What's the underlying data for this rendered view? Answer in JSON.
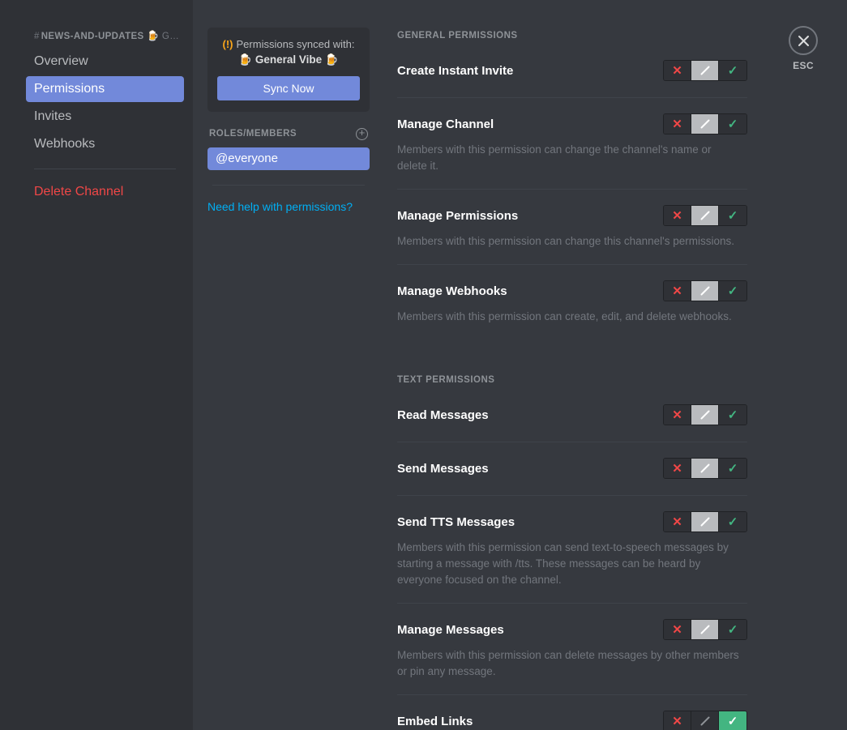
{
  "sidebar": {
    "channel_hash": "#",
    "channel_name": "NEWS-AND-UPDATES",
    "channel_emoji": "🍺",
    "channel_truncated": "G…",
    "items": [
      {
        "label": "Overview",
        "active": false,
        "danger": false
      },
      {
        "label": "Permissions",
        "active": true,
        "danger": false
      },
      {
        "label": "Invites",
        "active": false,
        "danger": false
      },
      {
        "label": "Webhooks",
        "active": false,
        "danger": false
      }
    ],
    "delete_label": "Delete Channel"
  },
  "middle": {
    "sync_warning_icon": "(!)",
    "sync_text": "Permissions synced with:",
    "sync_role": "🍺 General Vibe 🍺",
    "sync_button": "Sync Now",
    "roles_title": "ROLES/MEMBERS",
    "add_icon": "+",
    "roles": [
      {
        "label": "@everyone",
        "selected": true
      }
    ],
    "help_link": "Need help with permissions?"
  },
  "close": {
    "icon": "✕",
    "label": "ESC"
  },
  "colors": {
    "accent": "#7289da",
    "deny": "#f04747",
    "allow": "#43b581",
    "neutral": "#b9bbbe",
    "link": "#00aff4",
    "warning": "#faa61a",
    "sidebar_bg": "#2f3136",
    "main_bg": "#36393f"
  },
  "sections": [
    {
      "title": "GENERAL PERMISSIONS",
      "permissions": [
        {
          "label": "Create Instant Invite",
          "description": "",
          "state": "neutral"
        },
        {
          "label": "Manage Channel",
          "description": "Members with this permission can change the channel's name or delete it.",
          "state": "neutral"
        },
        {
          "label": "Manage Permissions",
          "description": "Members with this permission can change this channel's permissions.",
          "state": "neutral"
        },
        {
          "label": "Manage Webhooks",
          "description": "Members with this permission can create, edit, and delete webhooks.",
          "state": "neutral"
        }
      ]
    },
    {
      "title": "TEXT PERMISSIONS",
      "permissions": [
        {
          "label": "Read Messages",
          "description": "",
          "state": "neutral"
        },
        {
          "label": "Send Messages",
          "description": "",
          "state": "neutral"
        },
        {
          "label": "Send TTS Messages",
          "description": "Members with this permission can send text-to-speech messages by starting a message with /tts. These messages can be heard by everyone focused on the channel.",
          "state": "neutral"
        },
        {
          "label": "Manage Messages",
          "description": "Members with this permission can delete messages by other members or pin any message.",
          "state": "neutral"
        },
        {
          "label": "Embed Links",
          "description": "",
          "state": "allow"
        }
      ]
    }
  ],
  "toggle": {
    "deny_icon": "✕",
    "neutral_icon": "/",
    "allow_icon": "✓",
    "deny_name": "deny",
    "neutral_name": "neutral",
    "allow_name": "allow"
  }
}
